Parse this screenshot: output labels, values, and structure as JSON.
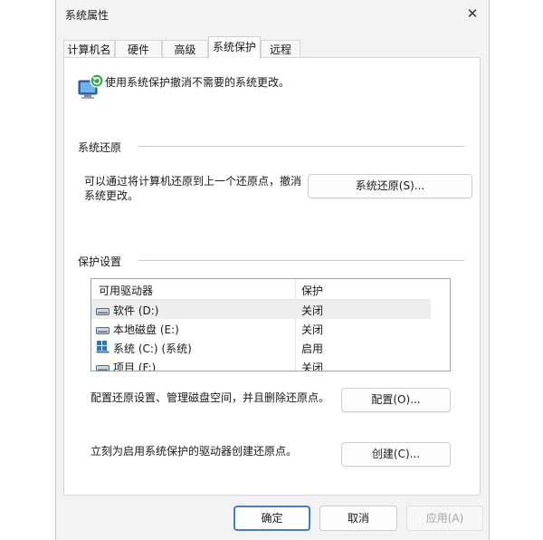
{
  "window": {
    "title": "系统属性",
    "close_glyph": "✕"
  },
  "tabs": [
    {
      "label": "计算机名",
      "active": false
    },
    {
      "label": "硬件",
      "active": false
    },
    {
      "label": "高级",
      "active": false
    },
    {
      "label": "系统保护",
      "active": true
    },
    {
      "label": "远程",
      "active": false
    }
  ],
  "intro": {
    "icon": "system-protection-icon",
    "text": "使用系统保护撤消不需要的系统更改。"
  },
  "restore": {
    "title": "系统还原",
    "description_line1": "可以通过将计算机还原到上一个还原点，撤消",
    "description_line2": "系统更改。",
    "button": "系统还原(S)..."
  },
  "protection": {
    "title": "保护设置",
    "columns": [
      "可用驱动器",
      "保护"
    ],
    "drives": [
      {
        "name": "软件 (D:)",
        "status": "关闭",
        "icon": "drive-icon",
        "selected": true
      },
      {
        "name": "本地磁盘 (E:)",
        "status": "关闭",
        "icon": "drive-icon",
        "selected": false
      },
      {
        "name": "系统 (C:) (系统)",
        "status": "启用",
        "icon": "windows-drive-icon",
        "selected": false
      },
      {
        "name": "项目 (F:)",
        "status": "关闭",
        "icon": "drive-icon",
        "selected": false
      }
    ],
    "configure_text": "配置还原设置、管理磁盘空间，并且删除还原点。",
    "configure_button": "配置(O)...",
    "create_text": "立刻为启用系统保护的驱动器创建还原点。",
    "create_button": "创建(C)..."
  },
  "footer": {
    "ok": "确定",
    "cancel": "取消",
    "apply": "应用(A)"
  },
  "colors": {
    "accent": "#3f7ec9",
    "window_bg": "#f3f3f3",
    "panel_bg": "#ffffff"
  }
}
